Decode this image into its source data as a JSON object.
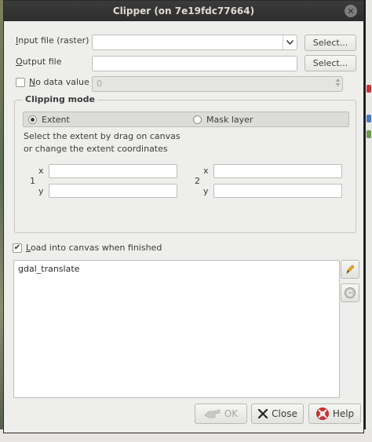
{
  "window": {
    "title": "Clipper (on 7e19fdc77664)",
    "close_glyph": "✕"
  },
  "input_file": {
    "label_access": "I",
    "label_rest": "nput file (raster)",
    "value": "",
    "button": "Select..."
  },
  "output_file": {
    "label_access": "O",
    "label_rest": "utput file",
    "value": "",
    "button": "Select..."
  },
  "no_data": {
    "label_access": "N",
    "label_rest": "o data value",
    "checked": false,
    "value": "0"
  },
  "clipping_mode": {
    "title": "Clipping mode",
    "options": [
      {
        "label": "Extent",
        "selected": true
      },
      {
        "label": "Mask layer",
        "selected": false
      }
    ],
    "instructions_line1": "Select the extent by drag on canvas",
    "instructions_line2": "or change the extent coordinates",
    "point1": {
      "index": "1",
      "x_label": "x",
      "y_label": "y",
      "x_value": "",
      "y_value": ""
    },
    "point2": {
      "index": "2",
      "x_label": "x",
      "y_label": "y",
      "x_value": "",
      "y_value": ""
    }
  },
  "load_into_canvas": {
    "label_access": "L",
    "label_rest": "oad into canvas when finished",
    "checked": true,
    "check_glyph": "✔"
  },
  "command": {
    "text": "gdal_translate"
  },
  "buttons": {
    "ok": {
      "label": "OK",
      "enabled": false
    },
    "close": {
      "label": "Close"
    },
    "help": {
      "label": "Help"
    }
  },
  "icons": {
    "edit": "pencil-icon",
    "reset": "reset-icon",
    "ok": "ok-hand-icon",
    "close": "close-x-icon",
    "help": "lifebuoy-icon"
  },
  "colors": {
    "title_bar": "#2e2e2e",
    "dialog_bg": "#eeeeec",
    "accent_close": "#d32f2f"
  }
}
